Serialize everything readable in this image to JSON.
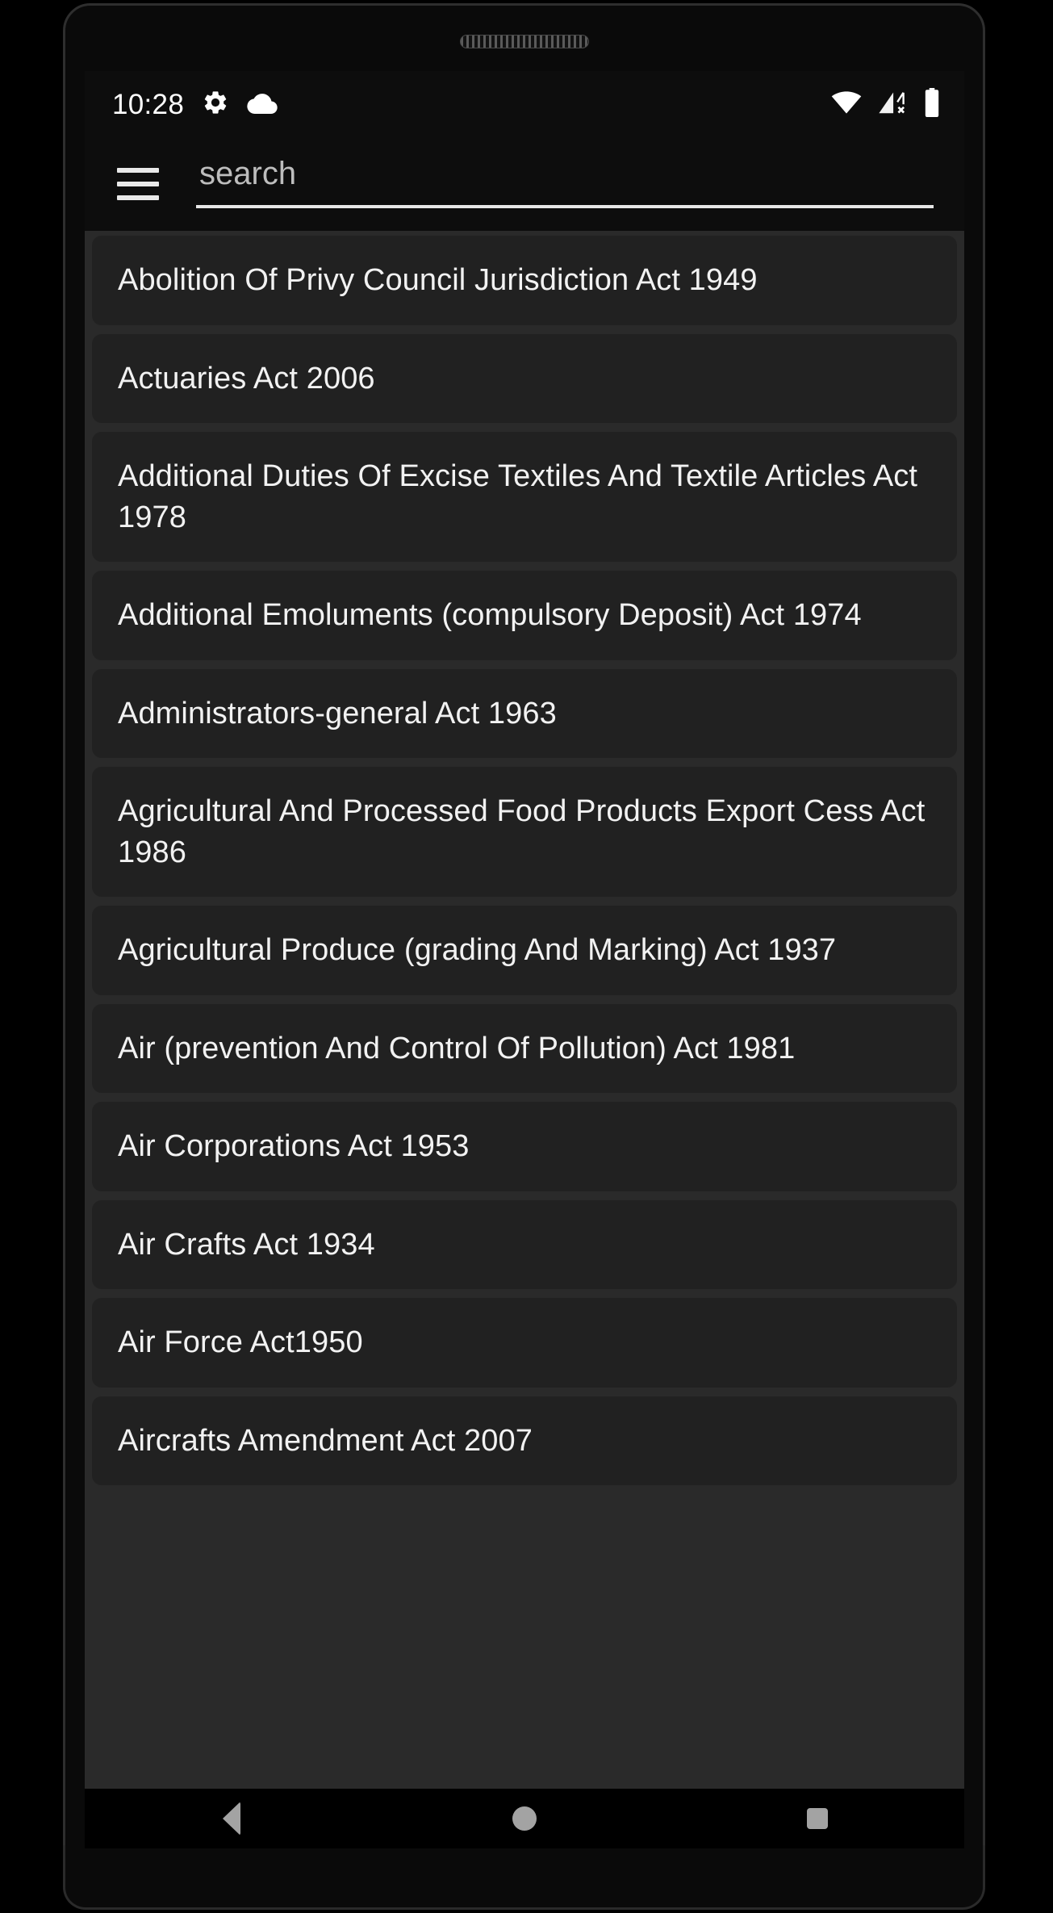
{
  "status_bar": {
    "time": "10:28",
    "left_icons": [
      "gear-icon",
      "cloud-icon"
    ],
    "right_icons": [
      "wifi-icon",
      "signal-no-sim-icon",
      "battery-full-icon"
    ],
    "background_color": "#0d0d0d",
    "text_color": "#ffffff"
  },
  "toolbar": {
    "menu_icon": "hamburger-menu-icon",
    "search": {
      "value": "",
      "placeholder": "search"
    },
    "background_color": "#0d0d0d"
  },
  "list": {
    "background_color": "#2a2a2a",
    "item_background_color": "#212121",
    "item_text_color": "#f2f2f2",
    "items": [
      {
        "label": "Abolition Of Privy Council Jurisdiction Act 1949"
      },
      {
        "label": "Actuaries Act 2006"
      },
      {
        "label": "Additional Duties Of Excise Textiles And Textile Articles Act 1978"
      },
      {
        "label": "Additional Emoluments (compulsory Deposit) Act 1974"
      },
      {
        "label": "Administrators-general Act 1963"
      },
      {
        "label": "Agricultural And Processed Food Products Export Cess Act 1986"
      },
      {
        "label": "Agricultural Produce (grading And Marking) Act 1937"
      },
      {
        "label": "Air (prevention And Control Of Pollution) Act 1981"
      },
      {
        "label": "Air Corporations Act 1953"
      },
      {
        "label": "Air Crafts Act 1934"
      },
      {
        "label": "Air Force Act1950"
      },
      {
        "label": "Aircrafts Amendment Act 2007"
      }
    ]
  },
  "navigation_bar": {
    "buttons": [
      {
        "name": "back-button",
        "icon": "triangle-back-icon"
      },
      {
        "name": "home-button",
        "icon": "circle-home-icon"
      },
      {
        "name": "recents-button",
        "icon": "square-recents-icon"
      }
    ],
    "background_color": "#000000",
    "icon_color": "#a3a3a3"
  }
}
